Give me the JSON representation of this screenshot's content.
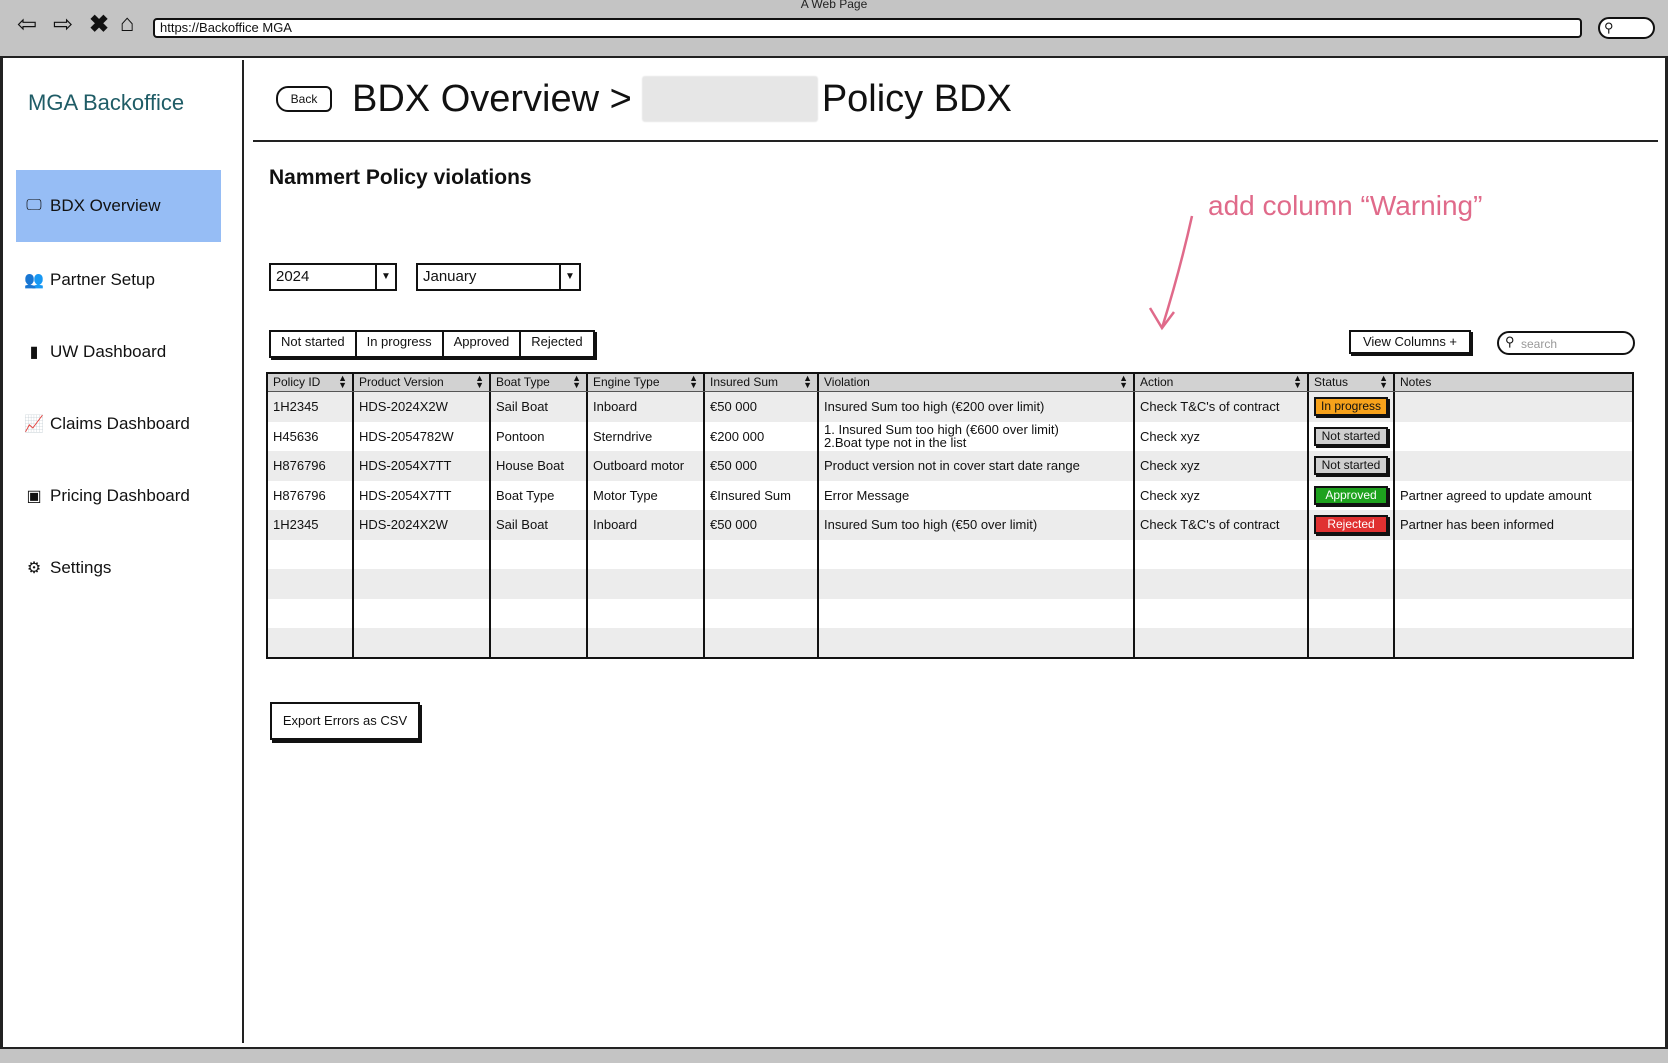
{
  "browser": {
    "window_title": "A Web Page",
    "url": "https://Backoffice MGA"
  },
  "sidebar": {
    "brand": "MGA Backoffice",
    "items": [
      {
        "label": "BDX Overview",
        "icon": "monitor-chart-icon",
        "active": true
      },
      {
        "label": "Partner Setup",
        "icon": "users-icon",
        "active": false
      },
      {
        "label": "UW Dashboard",
        "icon": "door-icon",
        "active": false
      },
      {
        "label": "Claims Dashboard",
        "icon": "line-chart-icon",
        "active": false
      },
      {
        "label": "Pricing Dashboard",
        "icon": "money-icon",
        "active": false
      },
      {
        "label": "Settings",
        "icon": "gear-icon",
        "active": false
      }
    ]
  },
  "header": {
    "back_label": "Back",
    "title_prefix": "BDX Overview >",
    "title_suffix": "Policy BDX"
  },
  "main": {
    "section_title": "Nammert Policy violations",
    "annotation": "add column “Warning”",
    "year_select": "2024",
    "month_select": "January",
    "status_filters": [
      "Not started",
      "In progress",
      "Approved",
      "Rejected"
    ],
    "view_columns_label": "View Columns +",
    "search_placeholder": "search",
    "export_label": "Export Errors as CSV"
  },
  "table": {
    "columns": [
      "Policy ID",
      "Product Version",
      "Boat Type",
      "Engine Type",
      "Insured Sum",
      "Violation",
      "Action",
      "Status",
      "Notes"
    ],
    "rows": [
      {
        "policy_id": "1H2345",
        "product_version": "HDS-2024X2W",
        "boat_type": "Sail Boat",
        "engine_type": "Inboard",
        "insured_sum": "€50 000",
        "violation": [
          "Insured Sum too high (€200 over limit)"
        ],
        "action": "Check T&C's of contract",
        "status": "In progress",
        "notes": ""
      },
      {
        "policy_id": "H45636",
        "product_version": "HDS-2054782W",
        "boat_type": "Pontoon",
        "engine_type": "Sterndrive",
        "insured_sum": "€200 000",
        "violation": [
          "1. Insured Sum too high (€600 over limit)",
          "2.Boat type not in the list"
        ],
        "action": "Check xyz",
        "status": "Not started",
        "notes": ""
      },
      {
        "policy_id": "H876796",
        "product_version": "HDS-2054X7TT",
        "boat_type": "House Boat",
        "engine_type": "Outboard motor",
        "insured_sum": "€50 000",
        "violation": [
          "Product version not in cover start date range"
        ],
        "action": "Check xyz",
        "status": "Not started",
        "notes": ""
      },
      {
        "policy_id": "H876796",
        "product_version": "HDS-2054X7TT",
        "boat_type": "Boat Type",
        "engine_type": "Motor Type",
        "insured_sum": "€Insured Sum",
        "violation": [
          "Error Message"
        ],
        "action": "Check xyz",
        "status": "Approved",
        "notes": "Partner agreed to update amount"
      },
      {
        "policy_id": "1H2345",
        "product_version": "HDS-2024X2W",
        "boat_type": "Sail Boat",
        "engine_type": "Inboard",
        "insured_sum": "€50 000",
        "violation": [
          "Insured Sum too high (€50 over limit)"
        ],
        "action": "Check T&C's of contract",
        "status": "Rejected",
        "notes": "Partner has been informed"
      }
    ],
    "empty_rows": 4
  },
  "status_colors": {
    "In progress": {
      "bg": "#f7a21b",
      "fg": "#111111"
    },
    "Not started": {
      "bg": "#cfcfcf",
      "fg": "#111111"
    },
    "Approved": {
      "bg": "#1ea21e",
      "fg": "#ffffff"
    },
    "Rejected": {
      "bg": "#e03131",
      "fg": "#ffffff"
    }
  },
  "colors": {
    "sidebar_active": "#96bdf5",
    "brand": "#1f5c66",
    "annotation": "#e06a8a"
  }
}
